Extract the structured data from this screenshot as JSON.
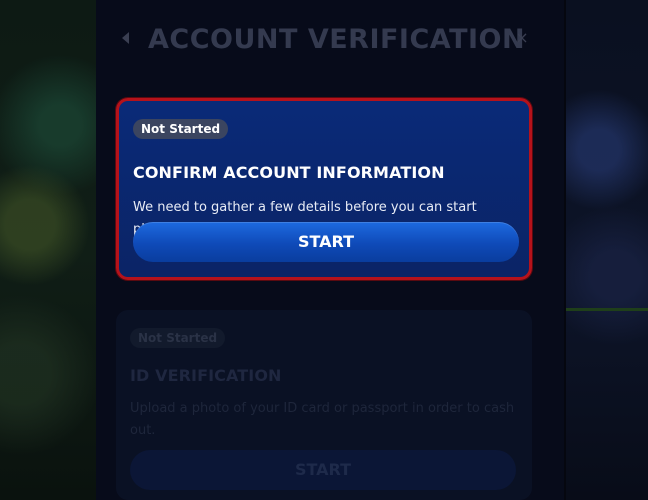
{
  "header": {
    "title": "ACCOUNT VERIFICATION",
    "back_icon": "chevron-left-icon",
    "close_icon": "close-icon",
    "close_glyph": "×"
  },
  "steps": [
    {
      "status": "Not Started",
      "title": "CONFIRM ACCOUNT INFORMATION",
      "description": "We need to gather a few details before you can start playing.",
      "button_label": "START",
      "highlighted": true
    },
    {
      "status": "Not Started",
      "title": "ID VERIFICATION",
      "description": "Upload a photo of your ID card or passport in order to cash out.",
      "button_label": "START",
      "highlighted": false
    }
  ],
  "colors": {
    "panel_bg": "#070b1a",
    "card_bg": "#0a2a78",
    "highlight_border": "#b5121b",
    "button_blue": "#1d6ae0"
  }
}
